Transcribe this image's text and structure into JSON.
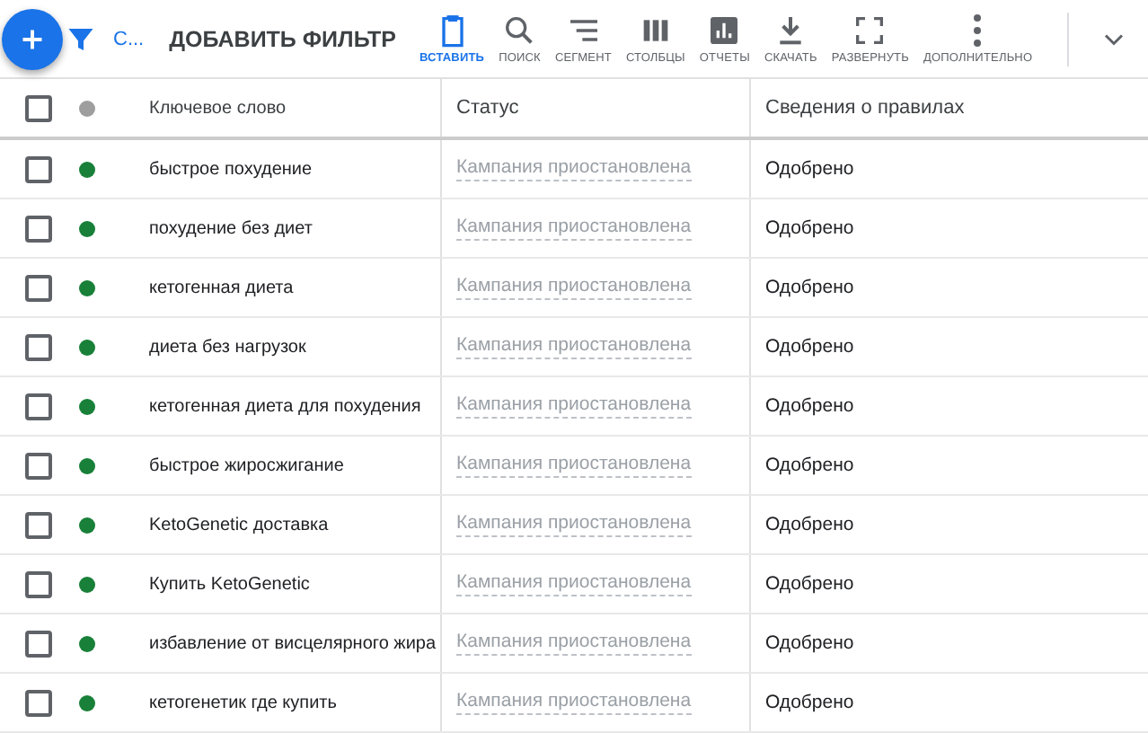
{
  "toolbar": {
    "segment_chip": "С...",
    "add_filter": "ДОБАВИТЬ ФИЛЬТР",
    "tools": [
      {
        "kind": "paste",
        "label": "ВСТАВИТЬ",
        "selected": true
      },
      {
        "kind": "search",
        "label": "ПОИСК",
        "selected": false
      },
      {
        "kind": "segment",
        "label": "СЕГМЕНТ",
        "selected": false
      },
      {
        "kind": "columns",
        "label": "СТОЛБЦЫ",
        "selected": false
      },
      {
        "kind": "reports",
        "label": "ОТЧЕТЫ",
        "selected": false
      },
      {
        "kind": "download",
        "label": "СКАЧАТЬ",
        "selected": false
      },
      {
        "kind": "expand",
        "label": "РАЗВЕРНУТЬ",
        "selected": false
      },
      {
        "kind": "more",
        "label": "ДОПОЛНИТЕЛЬНО",
        "selected": false
      }
    ]
  },
  "table": {
    "header": {
      "checked": false,
      "color": "#9e9e9e"
    },
    "columns": [
      "Ключевое слово",
      "Статус",
      "Сведения о правилах"
    ],
    "rows": [
      {
        "checked": false,
        "color": "#188038",
        "keyword": "быстрое похудение",
        "status": "Кампания приостановлена",
        "policy": "Одобрено"
      },
      {
        "checked": false,
        "color": "#188038",
        "keyword": "похудение без диет",
        "status": "Кампания приостановлена",
        "policy": "Одобрено"
      },
      {
        "checked": false,
        "color": "#188038",
        "keyword": "кетогенная диета",
        "status": "Кампания приостановлена",
        "policy": "Одобрено"
      },
      {
        "checked": false,
        "color": "#188038",
        "keyword": "диета без нагрузок",
        "status": "Кампания приостановлена",
        "policy": "Одобрено"
      },
      {
        "checked": false,
        "color": "#188038",
        "keyword": "кетогенная диета для похудения",
        "status": "Кампания приостановлена",
        "policy": "Одобрено"
      },
      {
        "checked": false,
        "color": "#188038",
        "keyword": "быстрое жиросжигание",
        "status": "Кампания приостановлена",
        "policy": "Одобрено"
      },
      {
        "checked": false,
        "color": "#188038",
        "keyword": "KetoGenetic доставка",
        "status": "Кампания приостановлена",
        "policy": "Одобрено"
      },
      {
        "checked": false,
        "color": "#188038",
        "keyword": "Купить KetoGenetic",
        "status": "Кампания приостановлена",
        "policy": "Одобрено"
      },
      {
        "checked": false,
        "color": "#188038",
        "keyword": "избавление от висцелярного жира",
        "status": "Кампания приостановлена",
        "policy": "Одобрено"
      },
      {
        "checked": false,
        "color": "#188038",
        "keyword": "кетогенетик где купить",
        "status": "Кампания приостановлена",
        "policy": "Одобрено"
      }
    ]
  }
}
